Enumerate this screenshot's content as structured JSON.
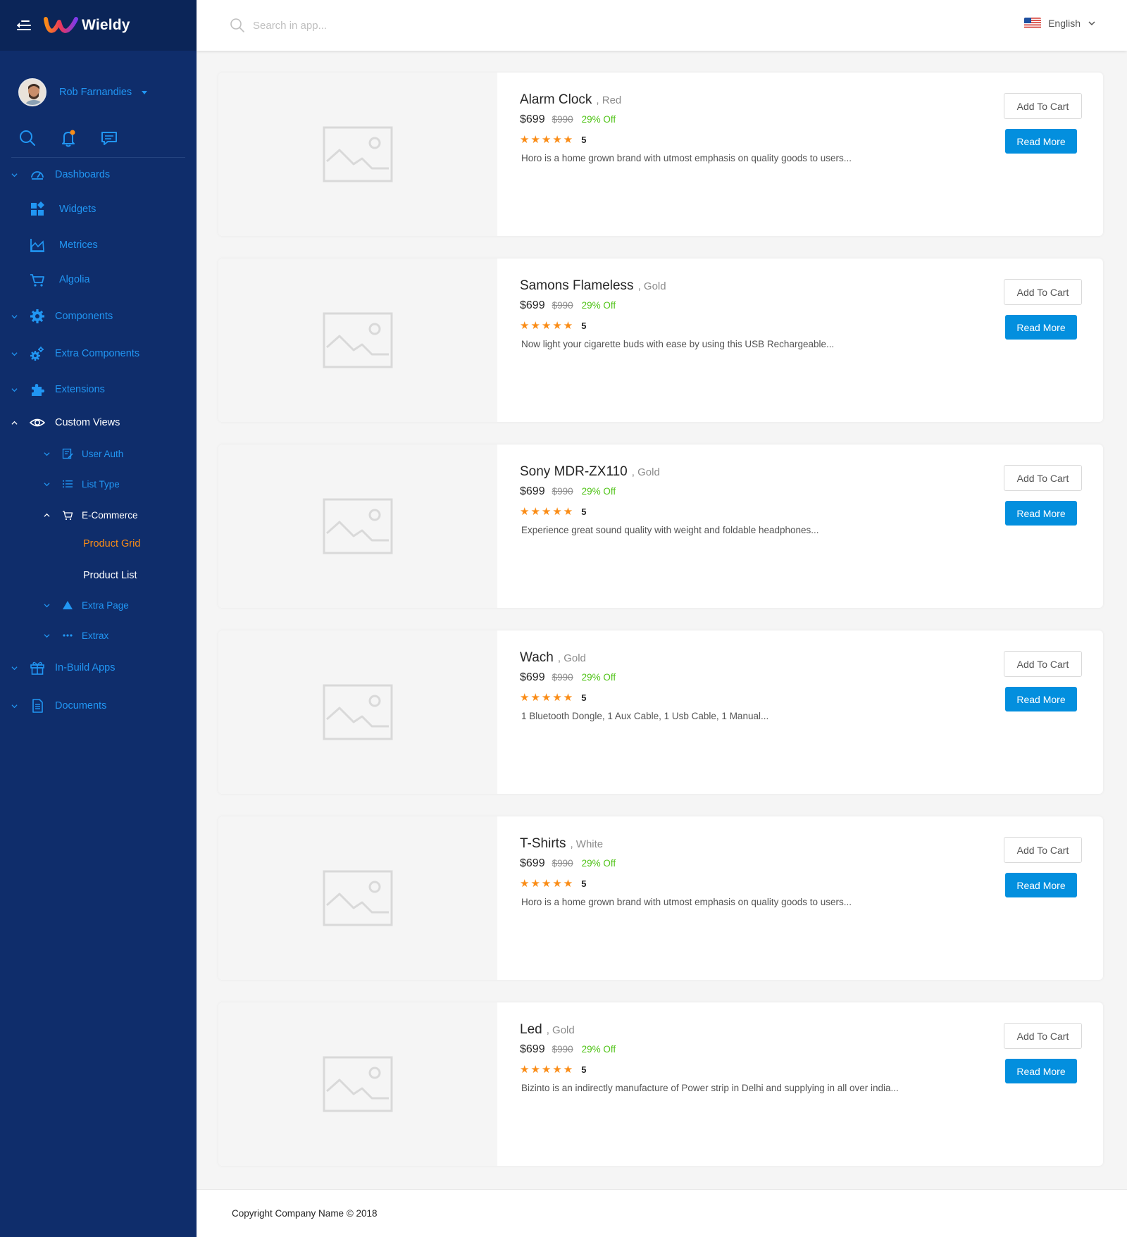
{
  "app": {
    "brand": "Wieldy"
  },
  "user": {
    "name": "Rob Farnandies"
  },
  "header": {
    "search_placeholder": "Search in app...",
    "language": "English"
  },
  "sidebar": {
    "items": [
      {
        "label": "Dashboards",
        "icon": "dashboard-icon"
      },
      {
        "label": "Widgets",
        "icon": "widgets-icon"
      },
      {
        "label": "Metrices",
        "icon": "chart-area-icon"
      },
      {
        "label": "Algolia",
        "icon": "cart-icon"
      },
      {
        "label": "Components",
        "icon": "gear-icon"
      },
      {
        "label": "Extra Components",
        "icon": "gears-icon"
      },
      {
        "label": "Extensions",
        "icon": "puzzle-icon"
      },
      {
        "label": "Custom Views",
        "icon": "eye-icon"
      },
      {
        "label": "User Auth",
        "icon": "auth-icon"
      },
      {
        "label": "List Type",
        "icon": "list-icon"
      },
      {
        "label": "E-Commerce",
        "icon": "shopping-icon"
      },
      {
        "label": "Product Grid"
      },
      {
        "label": "Product List"
      },
      {
        "label": "Extra Page",
        "icon": "triangle-icon"
      },
      {
        "label": "Extrax",
        "icon": "ellipsis-icon"
      },
      {
        "label": "In-Build Apps",
        "icon": "gift-icon"
      },
      {
        "label": "Documents",
        "icon": "document-icon"
      }
    ]
  },
  "products": [
    {
      "name": "Alarm Clock",
      "variant": ", Red",
      "price": "$699",
      "old_price": "$990",
      "discount": "29% Off",
      "stars": "★★★★★",
      "rating": "5",
      "description": "Horo is a home grown brand with utmost emphasis on quality goods to users..."
    },
    {
      "name": "Samons Flameless",
      "variant": ", Gold",
      "price": "$699",
      "old_price": "$990",
      "discount": "29% Off",
      "stars": "★★★★★",
      "rating": "5",
      "description": "Now light your cigarette buds with ease by using this USB Rechargeable..."
    },
    {
      "name": "Sony MDR-ZX110",
      "variant": ", Gold",
      "price": "$699",
      "old_price": "$990",
      "discount": "29% Off",
      "stars": "★★★★★",
      "rating": "5",
      "description": "Experience great sound quality with weight and foldable headphones..."
    },
    {
      "name": "Wach",
      "variant": ", Gold",
      "price": "$699",
      "old_price": "$990",
      "discount": "29% Off",
      "stars": "★★★★★",
      "rating": "5",
      "description": "1 Bluetooth Dongle, 1 Aux Cable, 1 Usb Cable, 1 Manual..."
    },
    {
      "name": "T-Shirts",
      "variant": ", White",
      "price": "$699",
      "old_price": "$990",
      "discount": "29% Off",
      "stars": "★★★★★",
      "rating": "5",
      "description": "Horo is a home grown brand with utmost emphasis on quality goods to users..."
    },
    {
      "name": "Led",
      "variant": ", Gold",
      "price": "$699",
      "old_price": "$990",
      "discount": "29% Off",
      "stars": "★★★★★",
      "rating": "5",
      "description": "Bizinto is an indirectly manufacture of Power strip in Delhi and supplying in all over india..."
    }
  ],
  "buttons": {
    "add_to_cart": "Add To Cart",
    "read_more": "Read More"
  },
  "footer": {
    "copyright": "Copyright Company Name © 2018"
  },
  "colors": {
    "sidebar_bg": "#0f2d6b",
    "accent": "#038fde",
    "active": "#fa8c16",
    "link": "#2196f3",
    "discount": "#52c41a"
  }
}
